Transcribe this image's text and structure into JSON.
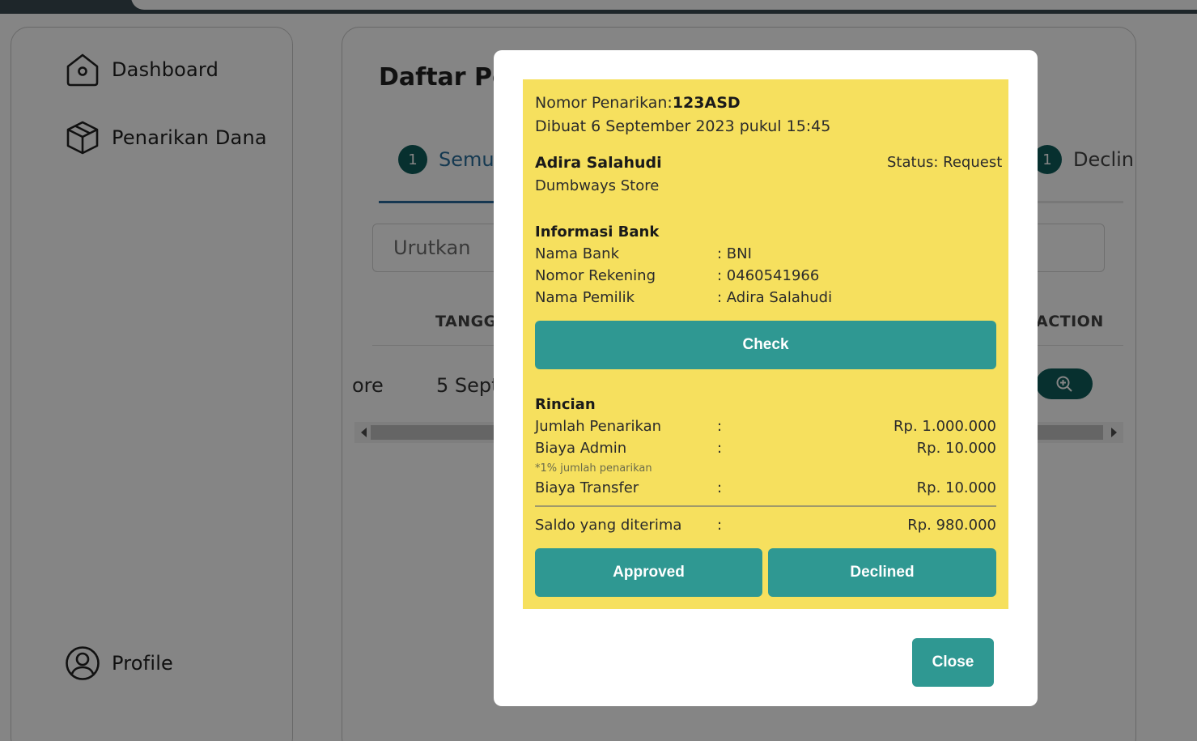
{
  "sidebar": {
    "items": [
      {
        "label": "Dashboard",
        "icon": "home-icon"
      },
      {
        "label": "Penarikan Dana",
        "icon": "box-icon"
      },
      {
        "label": "Profile",
        "icon": "user-circle-icon"
      }
    ]
  },
  "main": {
    "title": "Daftar Pen",
    "tabs": [
      {
        "label": "Semua",
        "count": "1"
      },
      {
        "label": "Declin",
        "count": "1"
      }
    ],
    "sort_placeholder": "Urutkan",
    "table": {
      "headers": [
        "TANGGA",
        "ACTION"
      ],
      "rows": [
        {
          "store": "ore",
          "date": "5 Sept"
        }
      ]
    }
  },
  "modal": {
    "withdrawal_label": "Nomor Penarikan:",
    "withdrawal_number": "123ASD",
    "created": "Dibuat 6 September 2023 pukul 15:45",
    "customer_name": "Adira Salahudi",
    "store_name": "Dumbways Store",
    "status": "Status: Request",
    "bank_info": {
      "heading": "Informasi Bank",
      "rows": [
        {
          "label": "Nama Bank",
          "value": ": BNI"
        },
        {
          "label": "Nomor Rekening",
          "value": ": 0460541966"
        },
        {
          "label": "Nama Pemilik",
          "value": ": Adira Salahudi"
        }
      ]
    },
    "check_label": "Check",
    "details": {
      "heading": "Rincian",
      "rows": [
        {
          "label": "Jumlah Penarikan",
          "sep": ":",
          "value": "Rp. 1.000.000"
        },
        {
          "label": "Biaya Admin",
          "sep": ":",
          "value": "Rp. 10.000",
          "note": "*1% jumlah penarikan"
        },
        {
          "label": "Biaya Transfer",
          "sep": ":",
          "value": "Rp. 10.000"
        }
      ],
      "total": {
        "label": "Saldo yang diterima",
        "sep": ":",
        "value": "Rp. 980.000"
      }
    },
    "approve_label": "Approved",
    "decline_label": "Declined",
    "close_label": "Close"
  },
  "colors": {
    "teal_button": "#2f9892",
    "dark_teal": "#0f5c5b",
    "card_yellow": "#f6e05e"
  }
}
